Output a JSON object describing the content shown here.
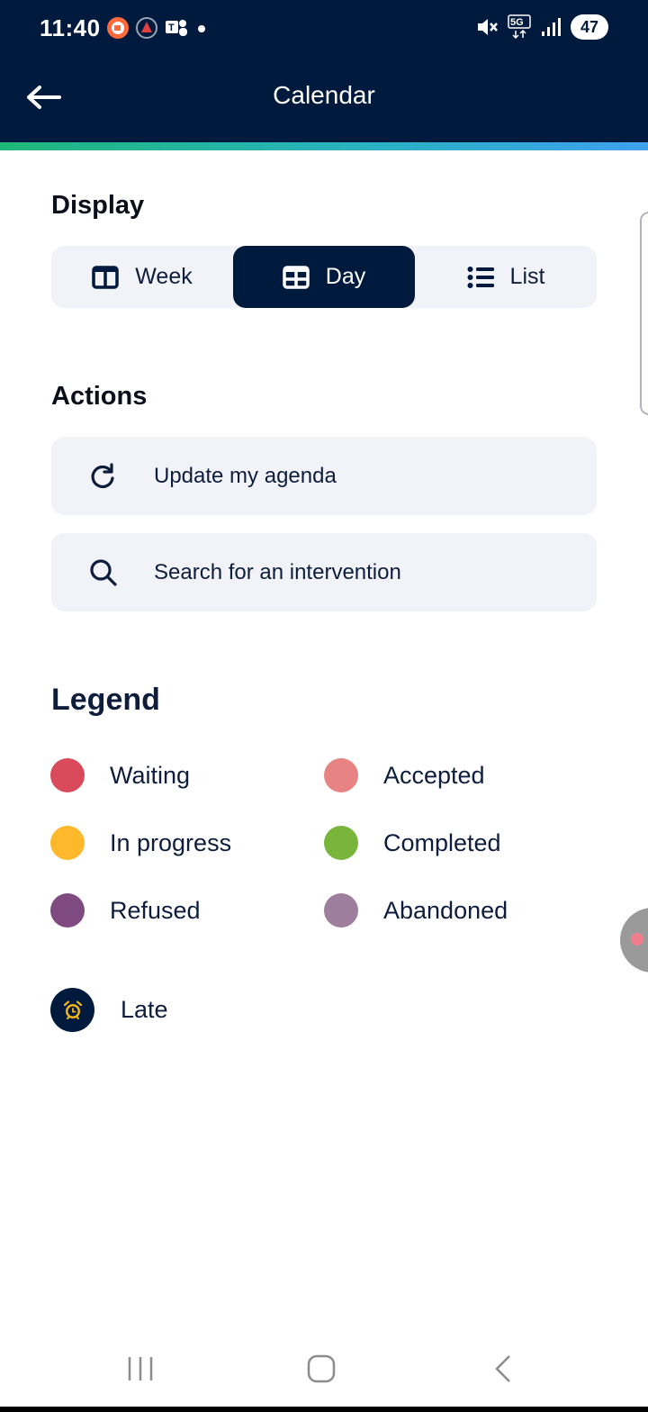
{
  "status_bar": {
    "time": "11:40",
    "network": "5G",
    "battery": "47"
  },
  "header": {
    "title": "Calendar"
  },
  "display": {
    "title": "Display",
    "options": [
      {
        "label": "Week",
        "icon": "columns-icon",
        "selected": false
      },
      {
        "label": "Day",
        "icon": "grid-icon",
        "selected": true
      },
      {
        "label": "List",
        "icon": "list-icon",
        "selected": false
      }
    ]
  },
  "actions": {
    "title": "Actions",
    "items": [
      {
        "label": "Update my agenda",
        "icon": "refresh-icon"
      },
      {
        "label": "Search for an intervention",
        "icon": "search-icon"
      }
    ]
  },
  "legend": {
    "title": "Legend",
    "items": [
      {
        "label": "Waiting",
        "color": "#d94a5a"
      },
      {
        "label": "Accepted",
        "color": "#e88383"
      },
      {
        "label": "In progress",
        "color": "#fdb92b"
      },
      {
        "label": "Completed",
        "color": "#79b53a"
      },
      {
        "label": "Refused",
        "color": "#7f4a80"
      },
      {
        "label": "Abandoned",
        "color": "#9d7e9c"
      }
    ],
    "late": {
      "label": "Late",
      "icon": "alarm-clock-icon"
    }
  },
  "colors": {
    "header_bg": "#001a3d",
    "selected_bg": "#001a3d",
    "button_bg": "#f2f3f8",
    "alarm_yellow": "#f3b51f"
  }
}
